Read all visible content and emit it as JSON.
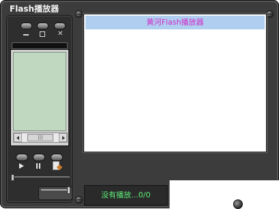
{
  "window": {
    "title": "Flash播放器"
  },
  "controls": {
    "minimize_icon": "minimize-icon",
    "maximize_icon": "maximize-icon",
    "close_icon": "close-icon"
  },
  "playback": {
    "play_icon": "play-icon",
    "pause_icon": "pause-icon",
    "playlist_icon": "playlist-icon"
  },
  "playlist": {
    "header": "黄河Flash播放器"
  },
  "status": {
    "text": "没有播放...0/0"
  },
  "colors": {
    "frame": "#3c3c3c",
    "header_bg": "#b0cff0",
    "header_text": "#d028c8",
    "screen": "#c0d8c0",
    "status_text": "#5ef07a"
  }
}
